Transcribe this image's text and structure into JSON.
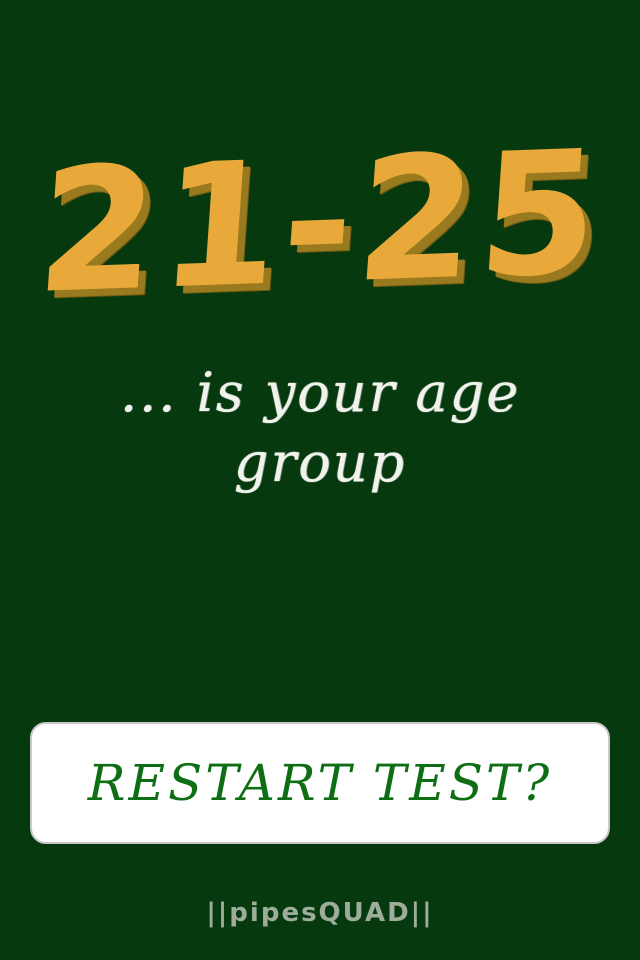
{
  "result": {
    "age_range": "21-25"
  },
  "caption": {
    "line1": "... is your age",
    "line2": "group"
  },
  "actions": {
    "restart_label": "RESTART TEST?"
  },
  "footer": {
    "brand": "||pipesQUAD||"
  },
  "colors": {
    "background": "#063a0e",
    "result_text": "#e8a83a",
    "result_shadow": "#9a7a1e",
    "caption_text": "#f2f2ec",
    "button_bg": "#ffffff",
    "button_text": "#0e6e14",
    "brand_text": "#9dac9b"
  }
}
